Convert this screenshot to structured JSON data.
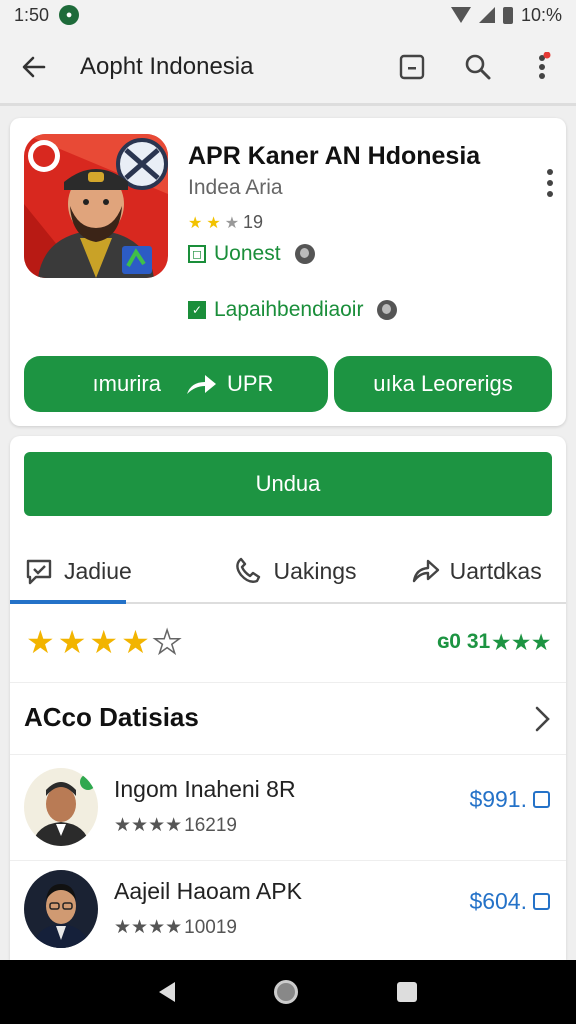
{
  "status_bar": {
    "time": "1:50",
    "battery": "10:%"
  },
  "app_bar": {
    "title": "Aopht Indonesia"
  },
  "app_card": {
    "name": "APR Kaner AN Hdonesia",
    "developer": "Indea Aria",
    "rating_count": "19",
    "tag_one": "Uonest",
    "tag_two": "Lapaihbendiaoir",
    "pill_one_left": "ımurira",
    "pill_one_right": "UPR",
    "pill_two": "uıka Leorerigs"
  },
  "install_button": "Undua",
  "tabs": [
    {
      "label": "Jadiue",
      "icon": "chat-icon"
    },
    {
      "label": "Uakings",
      "icon": "phone-icon"
    },
    {
      "label": "Uartdkas",
      "icon": "share-icon"
    }
  ],
  "rating_summary": {
    "stars": 4,
    "score": "ɢ0 31"
  },
  "section": {
    "title": "ACco Datisias"
  },
  "items": [
    {
      "title": "Ingom Inaheni 8R",
      "rating": "16219",
      "price": "$991."
    },
    {
      "title": "Aajeil Haoam APK",
      "rating": "10019",
      "price": "$604."
    }
  ],
  "colors": {
    "accent": "#1d9442",
    "link": "#2472c8",
    "star": "#f2b400"
  }
}
